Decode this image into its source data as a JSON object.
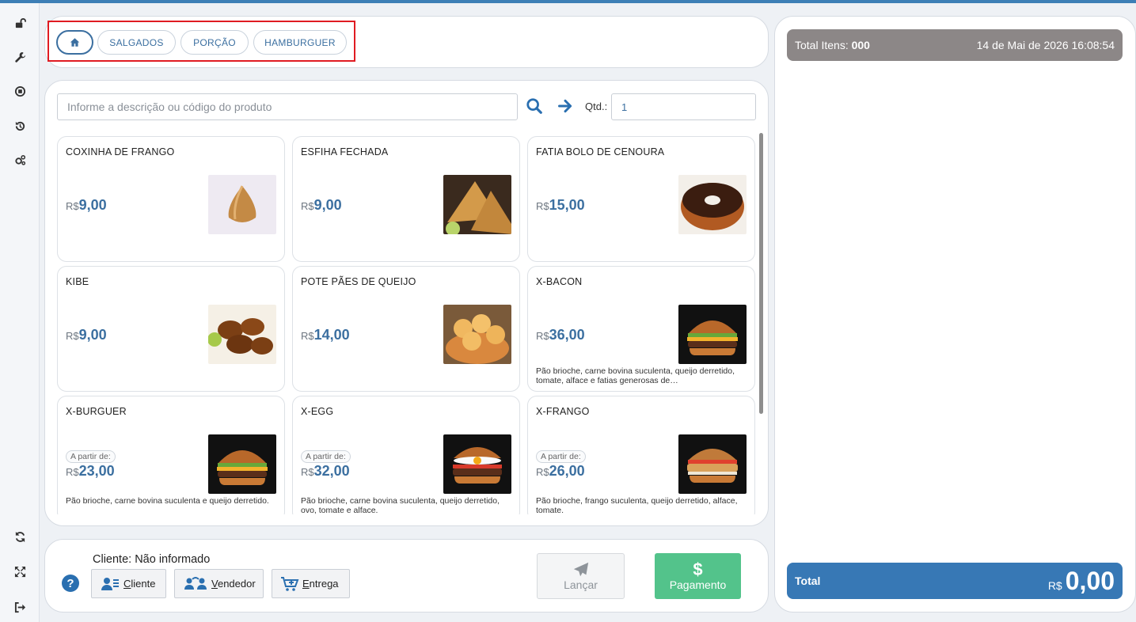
{
  "sidebar": {
    "top_icons": [
      "unlock-icon",
      "wrench-icon",
      "stop-circle-icon",
      "history-icon",
      "gears-icon"
    ],
    "bottom_icons": [
      "refresh-icon",
      "fullscreen-icon",
      "logout-icon"
    ]
  },
  "categories": {
    "home_icon": "home-icon",
    "items": [
      {
        "label": "SALGADOS"
      },
      {
        "label": "PORÇÃO"
      },
      {
        "label": "HAMBURGUER"
      }
    ]
  },
  "search": {
    "placeholder": "Informe a descrição ou código do produto",
    "qtd_label": "Qtd.:",
    "qtd_value": "1"
  },
  "products": [
    {
      "name": "COXINHA DE FRANGO",
      "currency": "R$",
      "price": "9,00",
      "from_label": "",
      "description": "",
      "image": "coxinha"
    },
    {
      "name": "ESFIHA FECHADA",
      "currency": "R$",
      "price": "9,00",
      "from_label": "",
      "description": "",
      "image": "esfiha"
    },
    {
      "name": "FATIA BOLO DE CENOURA",
      "currency": "R$",
      "price": "15,00",
      "from_label": "",
      "description": "",
      "image": "bolo"
    },
    {
      "name": "KIBE",
      "currency": "R$",
      "price": "9,00",
      "from_label": "",
      "description": "",
      "image": "kibe"
    },
    {
      "name": "POTE PÃES DE QUEIJO",
      "currency": "R$",
      "price": "14,00",
      "from_label": "",
      "description": "",
      "image": "paodequeijo"
    },
    {
      "name": "X-BACON",
      "currency": "R$",
      "price": "36,00",
      "from_label": "",
      "description": "Pão brioche, carne bovina suculenta, queijo derretido, tomate, alface e fatias generosas de…",
      "image": "burger"
    },
    {
      "name": "X-BURGUER",
      "currency": "R$",
      "price": "23,00",
      "from_label": "A partir de:",
      "description": "Pão brioche, carne bovina suculenta e queijo derretido.",
      "image": "burger"
    },
    {
      "name": "X-EGG",
      "currency": "R$",
      "price": "32,00",
      "from_label": "A partir de:",
      "description": "Pão brioche, carne bovina suculenta, queijo derretido, ovo, tomate e alface.",
      "image": "egg"
    },
    {
      "name": "X-FRANGO",
      "currency": "R$",
      "price": "26,00",
      "from_label": "A partir de:",
      "description": "Pão brioche, frango suculenta, queijo derretido, alface, tomate.",
      "image": "frango"
    }
  ],
  "bottom": {
    "cliente_text": "Cliente: Não informado",
    "help": "?",
    "cliente_btn": {
      "first": "C",
      "rest": "liente"
    },
    "vendedor_btn": {
      "first": "V",
      "rest": "endedor"
    },
    "entrega_btn": {
      "first": "E",
      "rest": "ntrega"
    },
    "lancar_label": "Lançar",
    "pagamento_label": "Pagamento",
    "pagamento_symbol": "$"
  },
  "summary": {
    "total_itens_label": "Total Itens:",
    "total_itens_value": "000",
    "datetime": "14 de Mai de 2026 16:08:54",
    "total_label": "Total",
    "total_currency": "R$",
    "total_value": "0,00"
  },
  "colors": {
    "accent": "#3b6fa0",
    "total_bar": "#3778b5",
    "pagamento": "#53c38b",
    "total_itens_bar": "#8c8787",
    "highlight": "#e01b22"
  }
}
